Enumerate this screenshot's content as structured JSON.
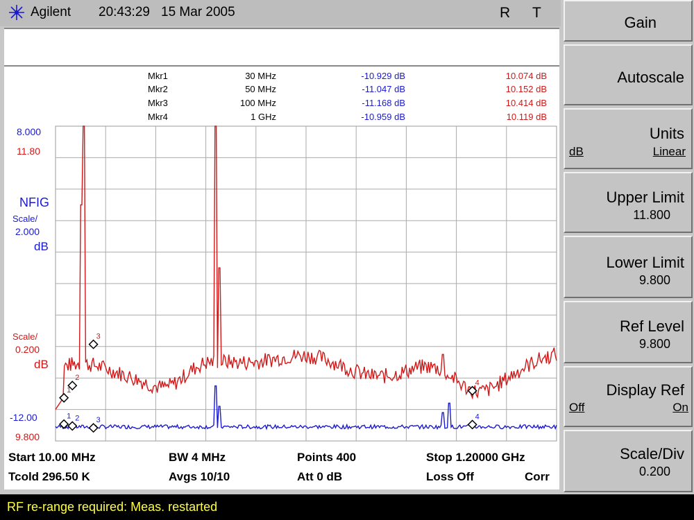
{
  "titlebar": {
    "brand": "Agilent",
    "time": "20:43:29",
    "date": "15 Mar 2005",
    "flag_r": "R",
    "flag_t": "T"
  },
  "markers": [
    {
      "name": "Mkr1",
      "freq": "30 MHz",
      "nf": "-10.929 dB",
      "gain": "10.074 dB"
    },
    {
      "name": "Mkr2",
      "freq": "50 MHz",
      "nf": "-11.047 dB",
      "gain": "10.152 dB"
    },
    {
      "name": "Mkr3",
      "freq": "100 MHz",
      "nf": "-11.168 dB",
      "gain": "10.414 dB"
    },
    {
      "name": "Mkr4",
      "freq": "1 GHz",
      "nf": "-10.959 dB",
      "gain": "10.119 dB"
    }
  ],
  "axis": {
    "nf_top": "8.000",
    "gain_top": "11.80",
    "nf_title": "NFIG",
    "nf_scale_label": "Scale/",
    "nf_scale": "2.000",
    "nf_unit": "dB",
    "gain_scale_label": "Scale/",
    "gain_scale": "0.200",
    "gain_unit": "dB",
    "nf_bottom": "-12.00",
    "gain_bottom": "9.800"
  },
  "footer": {
    "start": "Start 10.00 MHz",
    "tcold": "Tcold 296.50 K",
    "bw": "BW 4 MHz",
    "avgs": "Avgs 10/10",
    "points": "Points 400",
    "att": "Att 0 dB",
    "stop": "Stop 1.20000 GHz",
    "loss": "Loss Off",
    "corr": "Corr"
  },
  "status_message": "RF re-range required: Meas. restarted",
  "softkeys": {
    "title": "Gain",
    "autoscale": "Autoscale",
    "units": {
      "label": "Units",
      "opt_db": "dB",
      "opt_linear": "Linear"
    },
    "upper_limit": {
      "label": "Upper Limit",
      "value": "11.800"
    },
    "lower_limit": {
      "label": "Lower Limit",
      "value": "9.800"
    },
    "ref_level": {
      "label": "Ref Level",
      "value": "9.800"
    },
    "display_ref": {
      "label": "Display Ref",
      "opt_off": "Off",
      "opt_on": "On"
    },
    "scale_div": {
      "label": "Scale/Div",
      "value": "0.200"
    }
  },
  "colors": {
    "gain_trace": "#d01818",
    "nf_trace": "#1a1ad0",
    "status_text": "#ffff40"
  },
  "chart_data": {
    "type": "line",
    "x_start_mhz": 10,
    "x_stop_mhz": 1200,
    "series": [
      {
        "name": "NFIG",
        "units": "dB",
        "ylim": [
          -12,
          8
        ]
      },
      {
        "name": "Gain",
        "units": "dB",
        "ylim": [
          9.8,
          11.8
        ]
      }
    ],
    "markers": [
      {
        "label": "1",
        "x_mhz": 30,
        "nf_db": -10.929,
        "gain_db": 10.074
      },
      {
        "label": "2",
        "x_mhz": 50,
        "nf_db": -11.047,
        "gain_db": 10.152
      },
      {
        "label": "3",
        "x_mhz": 100,
        "nf_db": -11.168,
        "gain_db": 10.414
      },
      {
        "label": "4",
        "x_mhz": 1000,
        "nf_db": -10.959,
        "gain_db": 10.119
      }
    ],
    "grid": true
  }
}
